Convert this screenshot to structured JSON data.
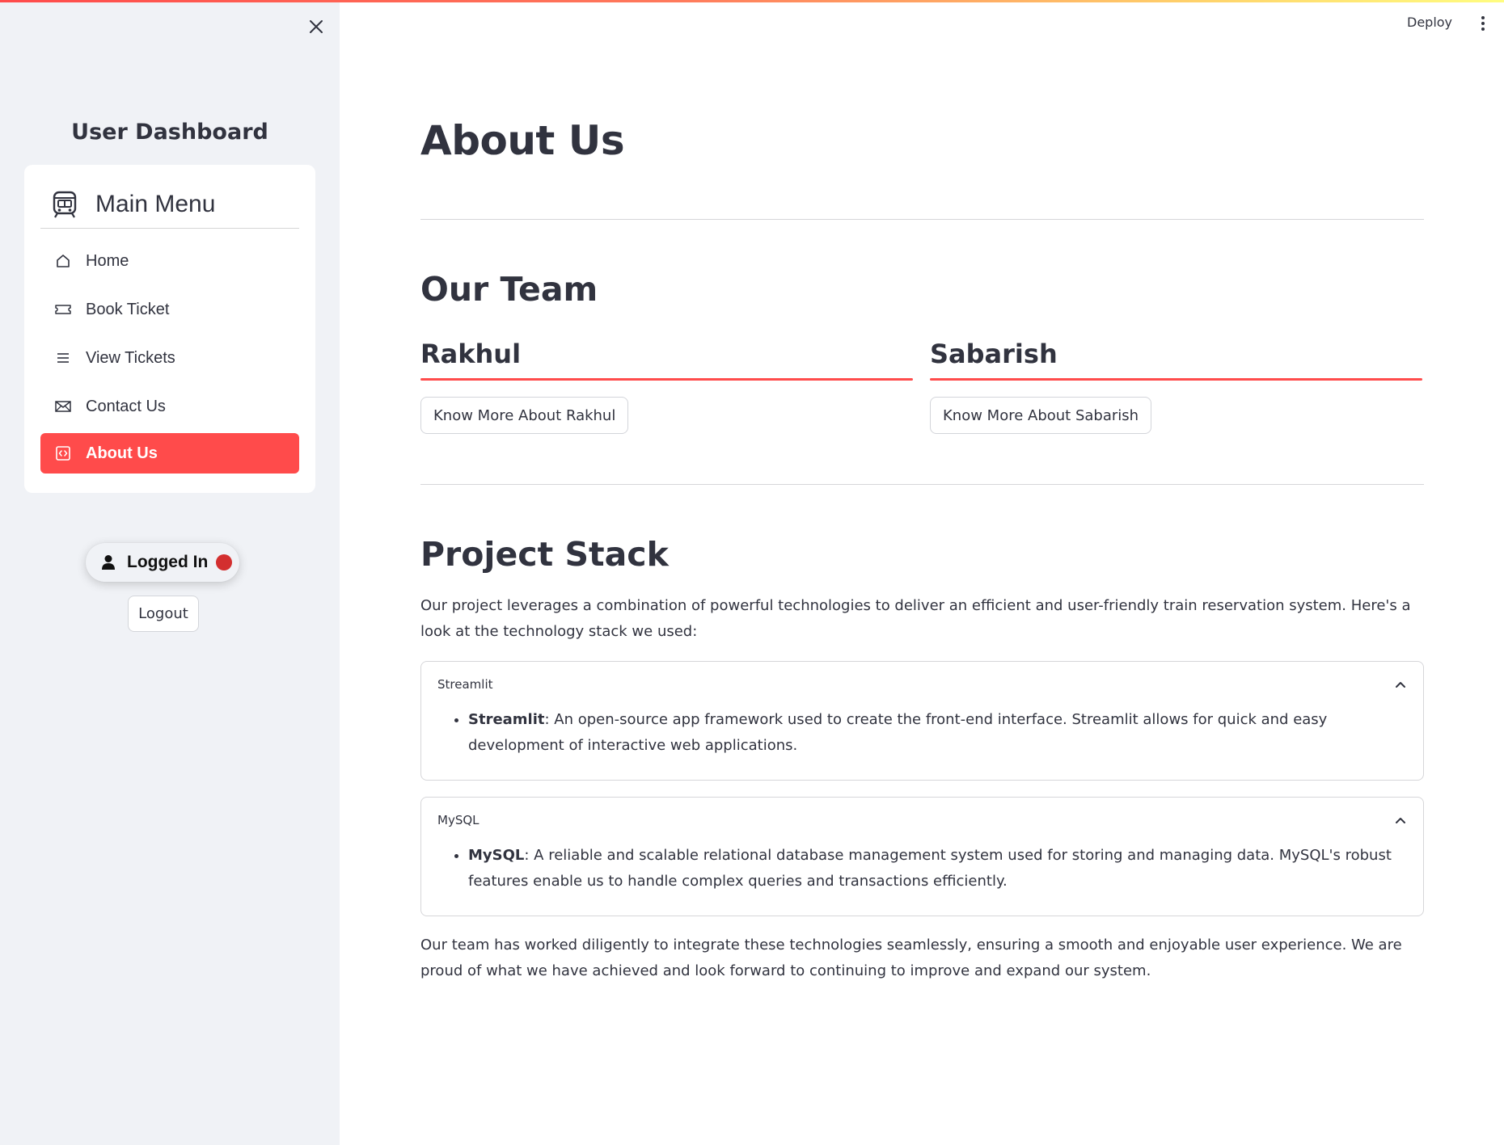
{
  "header": {
    "deploy_label": "Deploy"
  },
  "sidebar": {
    "title": "User Dashboard",
    "menu_title": "Main Menu",
    "items": [
      {
        "label": "Home",
        "icon": "house-icon"
      },
      {
        "label": "Book Ticket",
        "icon": "ticket-icon"
      },
      {
        "label": "View Tickets",
        "icon": "list-icon"
      },
      {
        "label": "Contact Us",
        "icon": "envelope-icon"
      },
      {
        "label": "About Us",
        "icon": "code-square-icon",
        "active": true
      }
    ],
    "status_label": "Logged In",
    "logout_label": "Logout"
  },
  "main": {
    "title": "About Us",
    "team_heading": "Our Team",
    "members": [
      {
        "name": "Rakhul",
        "button": "Know More About Rakhul"
      },
      {
        "name": "Sabarish",
        "button": "Know More About Sabarish"
      }
    ],
    "stack_heading": "Project Stack",
    "stack_intro": "Our project leverages a combination of powerful technologies to deliver an efficient and user-friendly train reservation system. Here's a look at the technology stack we used:",
    "expanders": [
      {
        "label": "Streamlit",
        "term": "Streamlit",
        "text": ": An open-source app framework used to create the front-end interface. Streamlit allows for quick and easy development of interactive web applications."
      },
      {
        "label": "MySQL",
        "term": "MySQL",
        "text": ": A reliable and scalable relational database management system used for storing and managing data. MySQL's robust features enable us to handle complex queries and transactions efficiently."
      }
    ],
    "closing": "Our team has worked diligently to integrate these technologies seamlessly, ensuring a smooth and enjoyable user experience. We are proud of what we have achieved and look forward to continuing to improve and expand our system."
  },
  "colors": {
    "accent": "#ff4b4b",
    "sidebar_bg": "#f0f2f6",
    "text": "#31333f",
    "status_dot": "#d32f2f"
  }
}
